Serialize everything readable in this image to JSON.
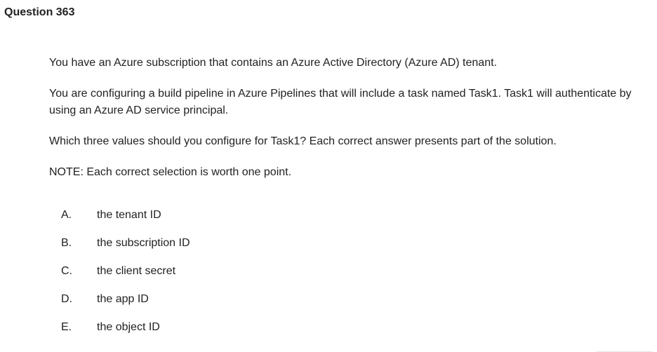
{
  "question": {
    "title": "Question 363",
    "paragraphs": [
      "You have an Azure subscription that contains an Azure Active Directory (Azure AD) tenant.",
      "You are configuring a build pipeline in Azure Pipelines that will include a task named Task1. Task1 will authenticate by using an Azure AD service principal.",
      "Which three values should you configure for Task1? Each correct answer presents part of the solution.",
      "NOTE: Each correct selection is worth one point."
    ],
    "options": [
      {
        "letter": "A.",
        "text": "the tenant ID"
      },
      {
        "letter": "B.",
        "text": "the subscription ID"
      },
      {
        "letter": "C.",
        "text": "the client secret"
      },
      {
        "letter": "D.",
        "text": "the app ID"
      },
      {
        "letter": "E.",
        "text": "the object ID"
      }
    ]
  }
}
